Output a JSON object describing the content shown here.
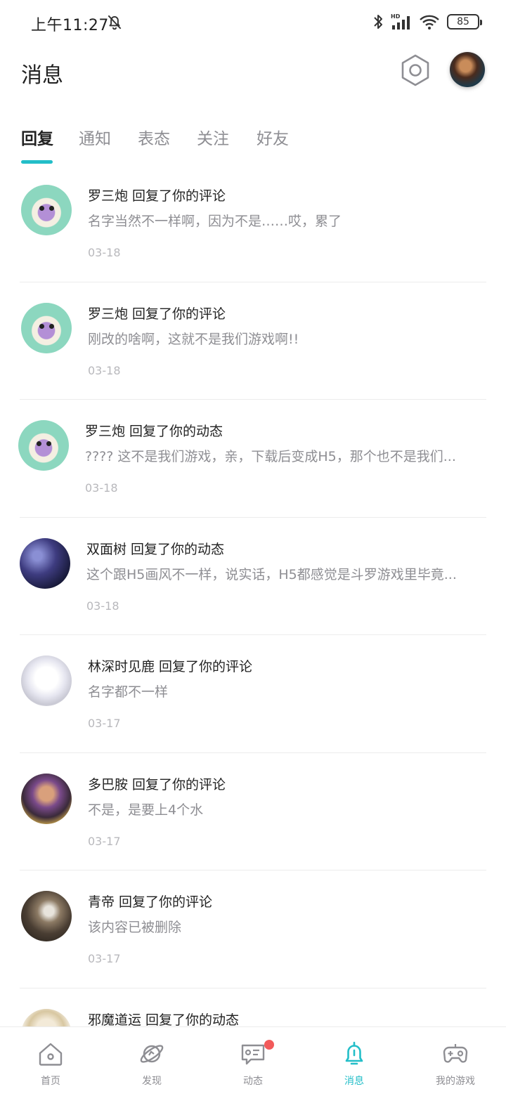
{
  "status_bar": {
    "time": "上午11:27",
    "battery": "85",
    "network_label": "HD"
  },
  "header": {
    "title": "消息"
  },
  "tabs": [
    {
      "label": "回复",
      "active": true
    },
    {
      "label": "通知",
      "active": false
    },
    {
      "label": "表态",
      "active": false
    },
    {
      "label": "关注",
      "active": false
    },
    {
      "label": "好友",
      "active": false
    }
  ],
  "messages": [
    {
      "title": "罗三炮 回复了你的评论",
      "body": "名字当然不一样啊，因为不是……哎，累了",
      "date": "03-18"
    },
    {
      "title": "罗三炮 回复了你的评论",
      "body": "刚改的啥啊，这就不是我们游戏啊!!",
      "date": "03-18"
    },
    {
      "title": "罗三炮 回复了你的动态",
      "body": "???? 这不是我们游戏，亲，下载后变成H5，那个也不是我们...",
      "date": "03-18"
    },
    {
      "title": "双面树 回复了你的动态",
      "body": "这个跟H5画风不一样，说实话，H5都感觉是斗罗游戏里毕竟...",
      "date": "03-18"
    },
    {
      "title": "林深时见鹿 回复了你的评论",
      "body": "名字都不一样",
      "date": "03-17"
    },
    {
      "title": "多巴胺 回复了你的评论",
      "body": "不是，是要上4个水",
      "date": "03-17"
    },
    {
      "title": "青帝 回复了你的评论",
      "body": "该内容已被删除",
      "date": "03-17"
    },
    {
      "title": "邪魔道运 回复了你的动态",
      "body": "",
      "date": ""
    }
  ],
  "bottom_nav": [
    {
      "label": "首页",
      "icon": "home-icon"
    },
    {
      "label": "发现",
      "icon": "planet-icon"
    },
    {
      "label": "动态",
      "icon": "chat-icon",
      "badge": true
    },
    {
      "label": "消息",
      "icon": "bell-icon",
      "active": true
    },
    {
      "label": "我的游戏",
      "icon": "gamepad-icon"
    }
  ],
  "colors": {
    "accent": "#23bec8",
    "badge": "#f25a5a",
    "muted_text": "#8e8e93"
  }
}
